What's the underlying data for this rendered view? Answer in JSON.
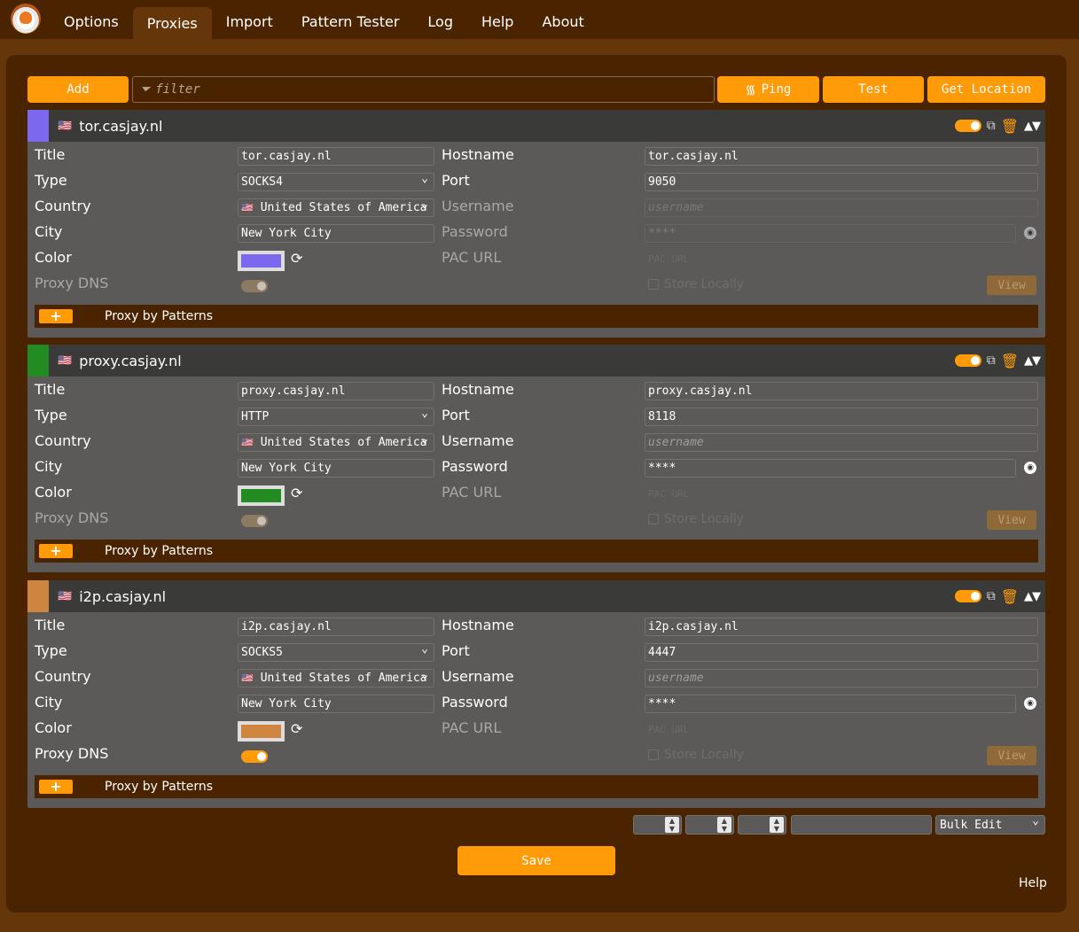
{
  "nav": {
    "logo_icon": "foxyproxy-logo",
    "tabs": [
      {
        "label": "Options"
      },
      {
        "label": "Proxies",
        "active": true
      },
      {
        "label": "Import"
      },
      {
        "label": "Pattern Tester"
      },
      {
        "label": "Log"
      },
      {
        "label": "Help"
      },
      {
        "label": "About"
      }
    ]
  },
  "toolbar": {
    "add_label": "Add",
    "filter_placeholder": "filter",
    "ping_label": "Ping",
    "test_label": "Test",
    "get_location_label": "Get Location"
  },
  "labels": {
    "title": "Title",
    "type": "Type",
    "country": "Country",
    "city": "City",
    "color": "Color",
    "proxy_dns": "Proxy DNS",
    "hostname": "Hostname",
    "port": "Port",
    "username": "Username",
    "password": "Password",
    "pac_url": "PAC URL",
    "store_locally": "Store Locally",
    "view": "View",
    "proxy_by_patterns": "Proxy by Patterns",
    "username_placeholder": "username",
    "pac_placeholder": "PAC URL"
  },
  "proxies": [
    {
      "flag": "🇺🇸",
      "title": "tor.casjay.nl",
      "type": "SOCKS4",
      "country": "United States of America",
      "city": "New York City",
      "color": "#7b68ee",
      "proxy_dns": false,
      "hostname": "tor.casjay.nl",
      "port": "9050",
      "username": "",
      "password": "****",
      "enabled": true
    },
    {
      "flag": "🇺🇸",
      "title": "proxy.casjay.nl",
      "type": "HTTP",
      "country": "United States of America",
      "city": "New York City",
      "color": "#228b22",
      "proxy_dns": false,
      "hostname": "proxy.casjay.nl",
      "port": "8118",
      "username": "",
      "password": "****",
      "enabled": true
    },
    {
      "flag": "🇺🇸",
      "title": "i2p.casjay.nl",
      "type": "SOCKS5",
      "country": "United States of America",
      "city": "New York City",
      "color": "#cd853f",
      "proxy_dns": true,
      "hostname": "i2p.casjay.nl",
      "port": "4447",
      "username": "",
      "password": "****",
      "enabled": true
    }
  ],
  "bulk": {
    "select_label": "Bulk Edit"
  },
  "footer": {
    "save_label": "Save",
    "help_label": "Help"
  }
}
